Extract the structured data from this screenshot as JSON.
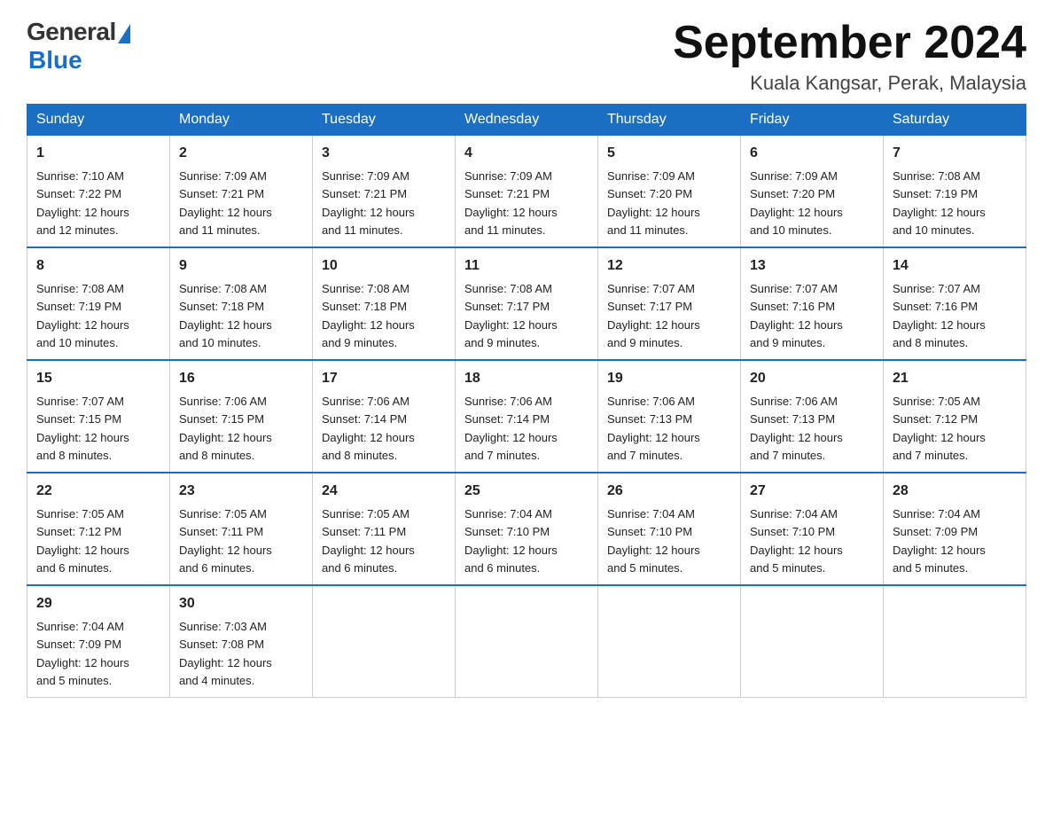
{
  "logo": {
    "general": "General",
    "blue": "Blue"
  },
  "title": "September 2024",
  "subtitle": "Kuala Kangsar, Perak, Malaysia",
  "days": [
    "Sunday",
    "Monday",
    "Tuesday",
    "Wednesday",
    "Thursday",
    "Friday",
    "Saturday"
  ],
  "weeks": [
    [
      {
        "date": "1",
        "sunrise": "7:10 AM",
        "sunset": "7:22 PM",
        "daylight": "12 hours and 12 minutes."
      },
      {
        "date": "2",
        "sunrise": "7:09 AM",
        "sunset": "7:21 PM",
        "daylight": "12 hours and 11 minutes."
      },
      {
        "date": "3",
        "sunrise": "7:09 AM",
        "sunset": "7:21 PM",
        "daylight": "12 hours and 11 minutes."
      },
      {
        "date": "4",
        "sunrise": "7:09 AM",
        "sunset": "7:21 PM",
        "daylight": "12 hours and 11 minutes."
      },
      {
        "date": "5",
        "sunrise": "7:09 AM",
        "sunset": "7:20 PM",
        "daylight": "12 hours and 11 minutes."
      },
      {
        "date": "6",
        "sunrise": "7:09 AM",
        "sunset": "7:20 PM",
        "daylight": "12 hours and 10 minutes."
      },
      {
        "date": "7",
        "sunrise": "7:08 AM",
        "sunset": "7:19 PM",
        "daylight": "12 hours and 10 minutes."
      }
    ],
    [
      {
        "date": "8",
        "sunrise": "7:08 AM",
        "sunset": "7:19 PM",
        "daylight": "12 hours and 10 minutes."
      },
      {
        "date": "9",
        "sunrise": "7:08 AM",
        "sunset": "7:18 PM",
        "daylight": "12 hours and 10 minutes."
      },
      {
        "date": "10",
        "sunrise": "7:08 AM",
        "sunset": "7:18 PM",
        "daylight": "12 hours and 9 minutes."
      },
      {
        "date": "11",
        "sunrise": "7:08 AM",
        "sunset": "7:17 PM",
        "daylight": "12 hours and 9 minutes."
      },
      {
        "date": "12",
        "sunrise": "7:07 AM",
        "sunset": "7:17 PM",
        "daylight": "12 hours and 9 minutes."
      },
      {
        "date": "13",
        "sunrise": "7:07 AM",
        "sunset": "7:16 PM",
        "daylight": "12 hours and 9 minutes."
      },
      {
        "date": "14",
        "sunrise": "7:07 AM",
        "sunset": "7:16 PM",
        "daylight": "12 hours and 8 minutes."
      }
    ],
    [
      {
        "date": "15",
        "sunrise": "7:07 AM",
        "sunset": "7:15 PM",
        "daylight": "12 hours and 8 minutes."
      },
      {
        "date": "16",
        "sunrise": "7:06 AM",
        "sunset": "7:15 PM",
        "daylight": "12 hours and 8 minutes."
      },
      {
        "date": "17",
        "sunrise": "7:06 AM",
        "sunset": "7:14 PM",
        "daylight": "12 hours and 8 minutes."
      },
      {
        "date": "18",
        "sunrise": "7:06 AM",
        "sunset": "7:14 PM",
        "daylight": "12 hours and 7 minutes."
      },
      {
        "date": "19",
        "sunrise": "7:06 AM",
        "sunset": "7:13 PM",
        "daylight": "12 hours and 7 minutes."
      },
      {
        "date": "20",
        "sunrise": "7:06 AM",
        "sunset": "7:13 PM",
        "daylight": "12 hours and 7 minutes."
      },
      {
        "date": "21",
        "sunrise": "7:05 AM",
        "sunset": "7:12 PM",
        "daylight": "12 hours and 7 minutes."
      }
    ],
    [
      {
        "date": "22",
        "sunrise": "7:05 AM",
        "sunset": "7:12 PM",
        "daylight": "12 hours and 6 minutes."
      },
      {
        "date": "23",
        "sunrise": "7:05 AM",
        "sunset": "7:11 PM",
        "daylight": "12 hours and 6 minutes."
      },
      {
        "date": "24",
        "sunrise": "7:05 AM",
        "sunset": "7:11 PM",
        "daylight": "12 hours and 6 minutes."
      },
      {
        "date": "25",
        "sunrise": "7:04 AM",
        "sunset": "7:10 PM",
        "daylight": "12 hours and 6 minutes."
      },
      {
        "date": "26",
        "sunrise": "7:04 AM",
        "sunset": "7:10 PM",
        "daylight": "12 hours and 5 minutes."
      },
      {
        "date": "27",
        "sunrise": "7:04 AM",
        "sunset": "7:10 PM",
        "daylight": "12 hours and 5 minutes."
      },
      {
        "date": "28",
        "sunrise": "7:04 AM",
        "sunset": "7:09 PM",
        "daylight": "12 hours and 5 minutes."
      }
    ],
    [
      {
        "date": "29",
        "sunrise": "7:04 AM",
        "sunset": "7:09 PM",
        "daylight": "12 hours and 5 minutes."
      },
      {
        "date": "30",
        "sunrise": "7:03 AM",
        "sunset": "7:08 PM",
        "daylight": "12 hours and 4 minutes."
      },
      null,
      null,
      null,
      null,
      null
    ]
  ]
}
